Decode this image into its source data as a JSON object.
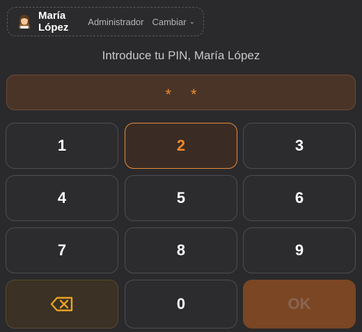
{
  "user": {
    "name": "María López",
    "role": "Administrador",
    "switch_label": "Cambiar",
    "avatar_icon": "woman-avatar-icon"
  },
  "prompt": "Introduce tu PIN, María López",
  "pin": {
    "masked": [
      "*",
      "*"
    ]
  },
  "keypad": {
    "keys": [
      "1",
      "2",
      "3",
      "4",
      "5",
      "6",
      "7",
      "8",
      "9"
    ],
    "zero": "0",
    "ok_label": "OK",
    "backspace_icon": "backspace-icon",
    "active_key": "2"
  },
  "colors": {
    "accent": "#f08a2e",
    "ok_bg": "#7a4624",
    "backspace": "#e8a322"
  }
}
